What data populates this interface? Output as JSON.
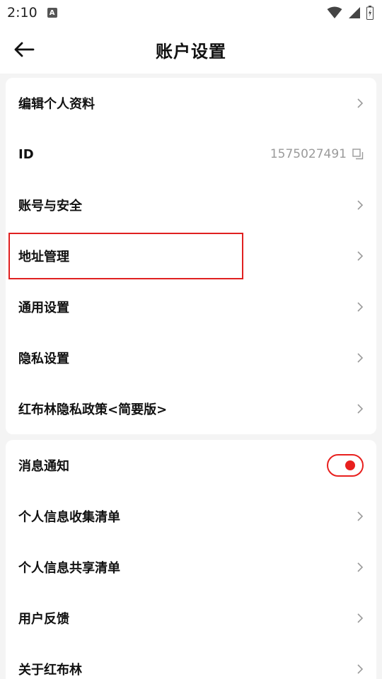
{
  "status_bar": {
    "time": "2:10",
    "notification_icon_letter": "A"
  },
  "header": {
    "title": "账户设置"
  },
  "settings_group_1": {
    "items": [
      {
        "label": "编辑个人资料"
      },
      {
        "label": "ID",
        "value": "1575027491"
      },
      {
        "label": "账号与安全"
      },
      {
        "label": "地址管理"
      },
      {
        "label": "通用设置"
      },
      {
        "label": "隐私设置"
      },
      {
        "label": "红布林隐私政策<简要版>"
      }
    ]
  },
  "settings_group_2": {
    "items": [
      {
        "label": "消息通知",
        "toggle_on": true
      },
      {
        "label": "个人信息收集清单"
      },
      {
        "label": "个人信息共享清单"
      },
      {
        "label": "用户反馈"
      },
      {
        "label": "关于红布林"
      }
    ]
  },
  "colors": {
    "accent": "#e8201e",
    "highlight_border": "#e02020",
    "muted_text": "#9a9a9a",
    "background": "#f4f4f4"
  }
}
